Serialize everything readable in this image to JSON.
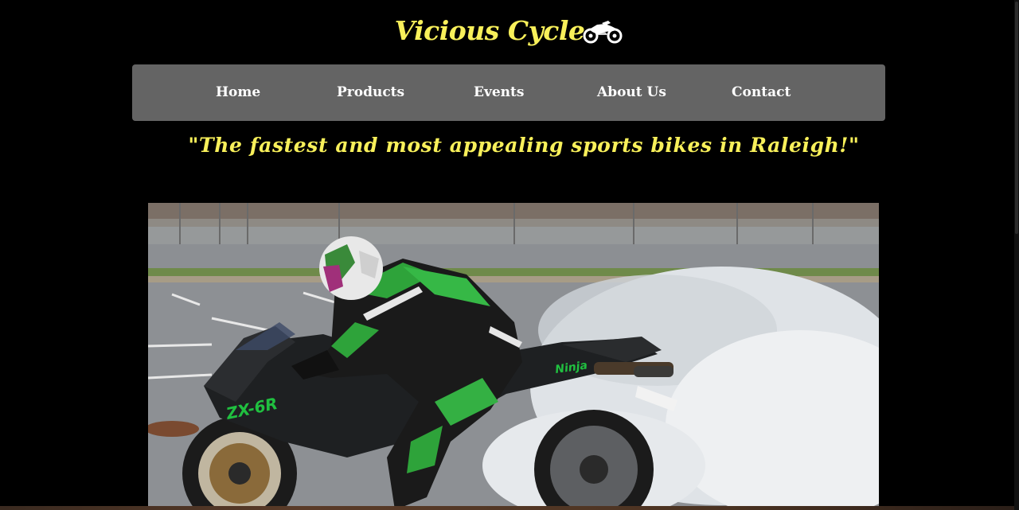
{
  "site": {
    "logo_text": "Vicious Cycle",
    "logo_icon": "motorcycle-icon"
  },
  "nav": {
    "items": [
      {
        "label": "Home"
      },
      {
        "label": "Products"
      },
      {
        "label": "Events"
      },
      {
        "label": "About Us"
      },
      {
        "label": "Contact"
      }
    ]
  },
  "tagline": "\"The fastest and most appealing sports bikes in Raleigh!\"",
  "hero": {
    "image_subject": "rider on green and black sport bike doing a burnout",
    "bike_decal_side": "ZX-6R",
    "bike_decal_tail": "Ninja"
  },
  "colors": {
    "background": "#000000",
    "accent_yellow": "#f8f05a",
    "nav_bg": "#646464",
    "nav_text": "#ffffff"
  }
}
